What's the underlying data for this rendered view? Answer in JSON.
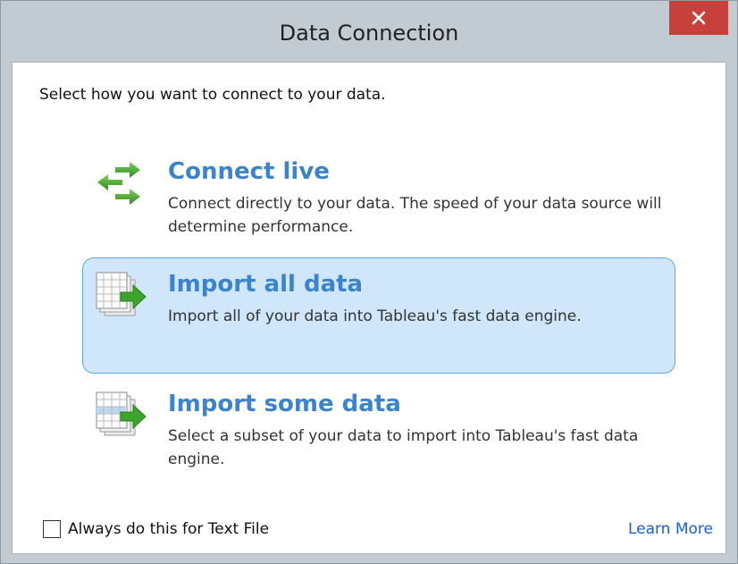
{
  "window": {
    "title": "Data Connection",
    "close_label": "×"
  },
  "prompt": "Select how you want to connect to your data.",
  "options": [
    {
      "title": "Connect live",
      "description": "Connect directly to your data. The speed of your data source will determine performance.",
      "icon": "swap-arrows-icon",
      "selected": false
    },
    {
      "title": "Import all data",
      "description": "Import all of your data into Tableau's fast data engine.",
      "icon": "import-table-icon",
      "selected": true
    },
    {
      "title": "Import some data",
      "description": "Select a subset of your data to import into Tableau's fast data engine.",
      "icon": "import-subset-table-icon",
      "selected": false
    }
  ],
  "footer": {
    "checkbox_label": "Always do this for Text File",
    "checkbox_checked": false,
    "learn_more": "Learn More"
  },
  "colors": {
    "accent": "#3b84cc",
    "selected_bg": "#cfe6fb",
    "selected_border": "#62a7e4",
    "close_bg": "#c7403b",
    "link": "#1a5fd4"
  }
}
